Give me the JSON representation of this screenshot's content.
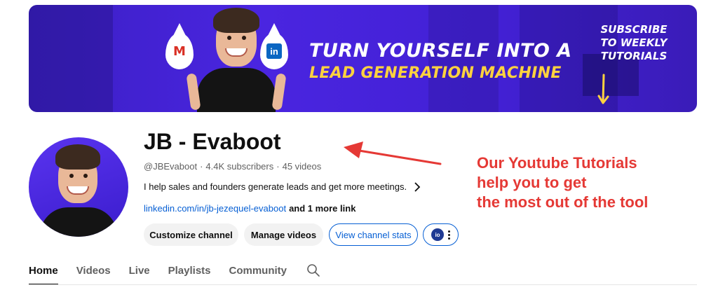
{
  "banner": {
    "headline_line1": "TURN YOURSELF INTO A",
    "headline_line2": "LEAD GENERATION MACHINE",
    "subscribe_lines": [
      "SUBSCRIBE",
      "TO WEEKLY",
      "TUTORIALS"
    ],
    "gmail_glyph": "M",
    "linkedin_glyph": "in",
    "colors": {
      "background": "#4322d8",
      "headline": "#ffffff",
      "highlight": "#ffd23f"
    }
  },
  "channel": {
    "name": "JB - Evaboot",
    "handle": "@JBEvaboot",
    "subscribers": "4.4K subscribers",
    "videos": "45 videos",
    "separator": "·",
    "description": "I help sales and founders generate leads and get more meetings.",
    "link": "linkedin.com/in/jb-jezequel-evaboot",
    "more_links": "and 1 more link"
  },
  "buttons": {
    "customize": "Customize channel",
    "manage": "Manage videos",
    "stats": "View channel stats",
    "extension_glyph": "io"
  },
  "annotation": {
    "lines": [
      "Our Youtube Tutorials",
      "help you to get",
      "the most out of the tool"
    ],
    "color": "#e53935"
  },
  "tabs": [
    {
      "label": "Home",
      "active": true
    },
    {
      "label": "Videos",
      "active": false
    },
    {
      "label": "Live",
      "active": false
    },
    {
      "label": "Playlists",
      "active": false
    },
    {
      "label": "Community",
      "active": false
    }
  ],
  "icons": {
    "search": "search-icon",
    "chevron": "chevron-right-icon",
    "more": "more-vert-icon"
  }
}
